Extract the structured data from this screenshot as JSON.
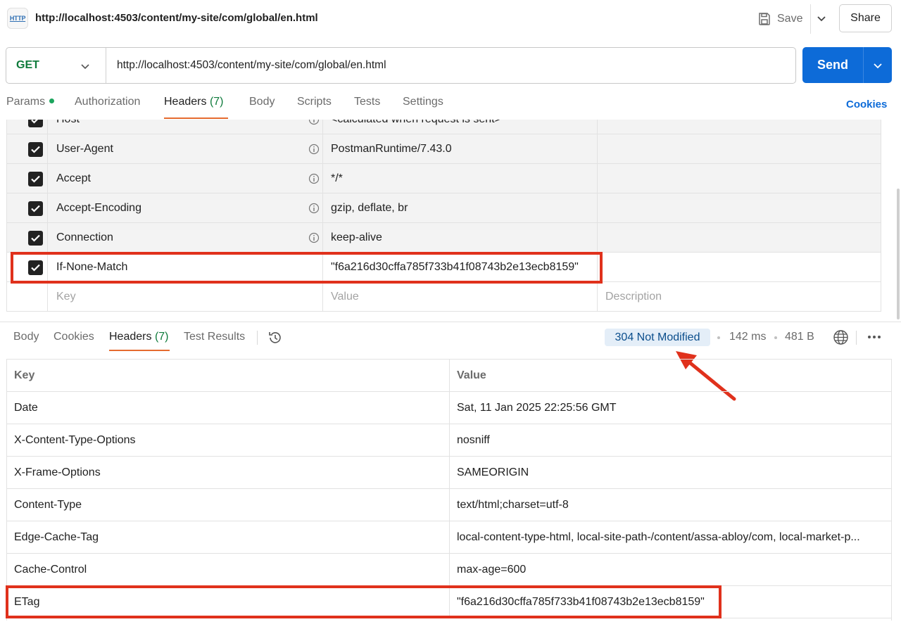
{
  "header": {
    "icon_label": "HTTP",
    "title": "http://localhost:4503/content/my-site/com/global/en.html",
    "save_label": "Save",
    "share_label": "Share"
  },
  "request": {
    "method": "GET",
    "url": "http://localhost:4503/content/my-site/com/global/en.html",
    "send_label": "Send"
  },
  "request_tabs": {
    "params": "Params",
    "authorization": "Authorization",
    "headers": "Headers",
    "headers_count": "(7)",
    "body": "Body",
    "scripts": "Scripts",
    "tests": "Tests",
    "settings": "Settings",
    "cookies": "Cookies"
  },
  "request_headers": [
    {
      "key": "Host",
      "value": "<calculated when request is sent>",
      "checked": true
    },
    {
      "key": "User-Agent",
      "value": "PostmanRuntime/7.43.0",
      "checked": true
    },
    {
      "key": "Accept",
      "value": "*/*",
      "checked": true
    },
    {
      "key": "Accept-Encoding",
      "value": "gzip, deflate, br",
      "checked": true
    },
    {
      "key": "Connection",
      "value": "keep-alive",
      "checked": true
    },
    {
      "key": "If-None-Match",
      "value": "\"f6a216d30cffa785f733b41f08743b2e13ecb8159\"",
      "checked": true
    }
  ],
  "new_header_placeholders": {
    "key": "Key",
    "value": "Value",
    "description": "Description"
  },
  "response_tabs": {
    "body": "Body",
    "cookies": "Cookies",
    "headers": "Headers",
    "headers_count": "(7)",
    "test_results": "Test Results"
  },
  "response_meta": {
    "status": "304 Not Modified",
    "time": "142 ms",
    "size": "481 B"
  },
  "response_table": {
    "key_header": "Key",
    "value_header": "Value",
    "rows": [
      {
        "key": "Date",
        "value": "Sat, 11 Jan 2025 22:25:56 GMT"
      },
      {
        "key": "X-Content-Type-Options",
        "value": "nosniff"
      },
      {
        "key": "X-Frame-Options",
        "value": "SAMEORIGIN"
      },
      {
        "key": "Content-Type",
        "value": "text/html;charset=utf-8"
      },
      {
        "key": "Edge-Cache-Tag",
        "value": "local-content-type-html, local-site-path-/content/assa-abloy/com, local-market-p..."
      },
      {
        "key": "Cache-Control",
        "value": "max-age=600"
      },
      {
        "key": "ETag",
        "value": "\"f6a216d30cffa785f733b41f08743b2e13ecb8159\""
      }
    ]
  },
  "colors": {
    "accent": "#0d6bd8",
    "method_green": "#0f7b3c",
    "tab_underline": "#e56b2f",
    "annotation_red": "#e0311c",
    "status_bg": "#e4eef8"
  },
  "icons": [
    "http-icon",
    "save-icon",
    "chevron-down-icon",
    "info-icon",
    "checkbox-icon",
    "history-icon",
    "globe-icon",
    "more-icon",
    "annotation-arrow"
  ]
}
